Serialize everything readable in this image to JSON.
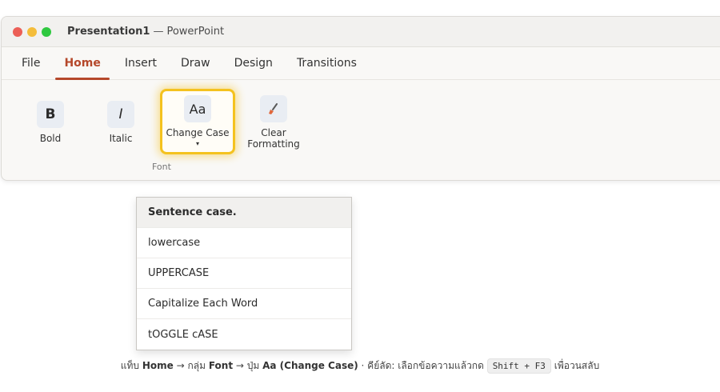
{
  "window": {
    "doc_title": "Presentation1",
    "separator": "—",
    "app_name": "PowerPoint"
  },
  "tabs": [
    "File",
    "Home",
    "Insert",
    "Draw",
    "Design",
    "Transitions"
  ],
  "active_tab": "Home",
  "ribbon": {
    "bold": {
      "icon": "B",
      "label": "Bold"
    },
    "italic": {
      "icon": "I",
      "label": "Italic"
    },
    "change_case": {
      "icon": "Aa",
      "label": "Change Case",
      "caret": "▾"
    },
    "clear_formatting": {
      "label_line1": "Clear",
      "label_line2": "Formatting"
    },
    "group_label": "Font"
  },
  "dropdown": {
    "items": [
      "Sentence case.",
      "lowercase",
      "UPPERCASE",
      "Capitalize Each Word",
      "tOGGLE cASE"
    ],
    "selected_index": 0
  },
  "caption": {
    "p1": "แท็บ ",
    "home": "Home",
    "p2": " → กลุ่ม ",
    "font": "Font",
    "p3": " → ปุ่ม ",
    "aa": "Aa (Change Case)",
    "p4": "  ·  คีย์ลัด: เลือกข้อความแล้วกด ",
    "shortcut": "Shift + F3",
    "p5": " เพื่อวนสลับ"
  },
  "colors": {
    "accent": "#b5482b",
    "highlight": "#f4c21f"
  }
}
